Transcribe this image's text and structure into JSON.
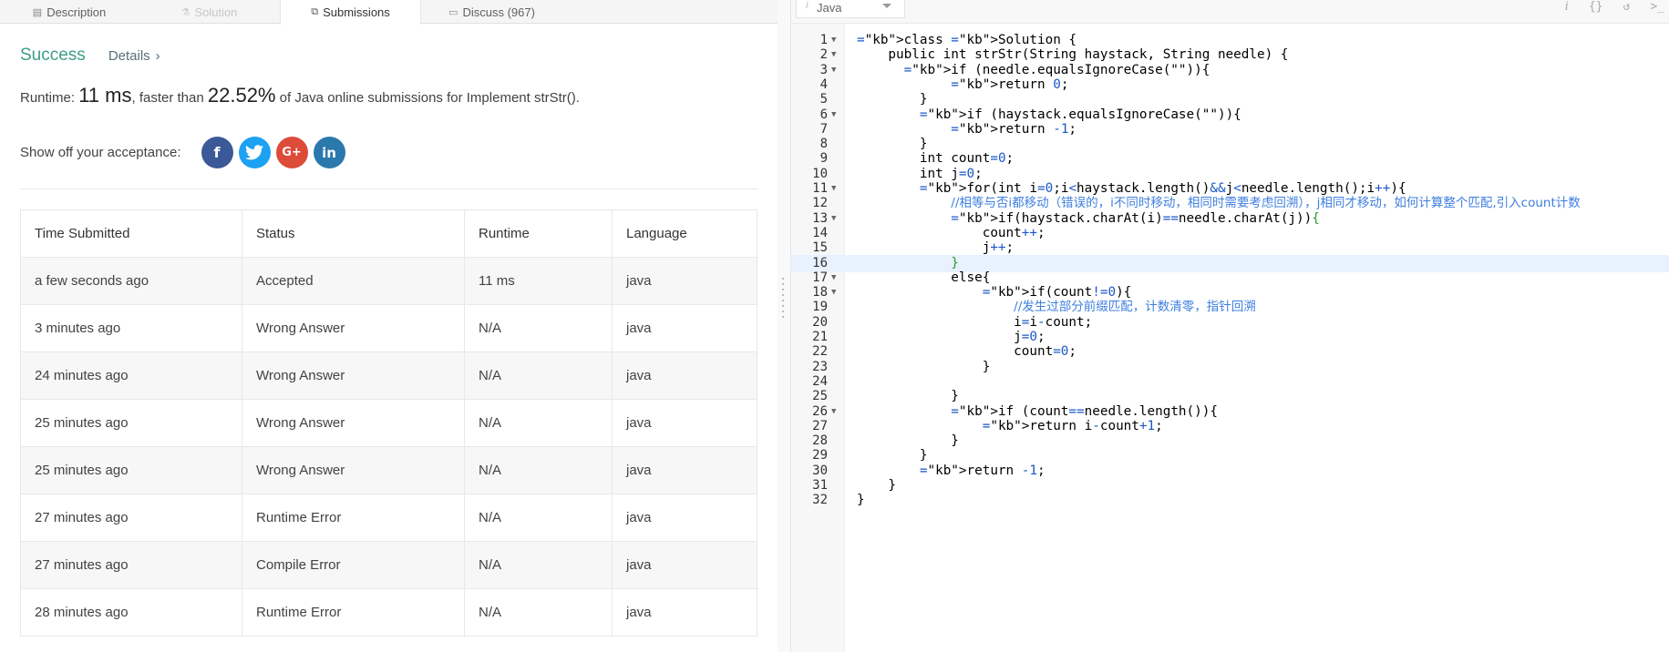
{
  "tabs": [
    {
      "icon": "description-icon",
      "glyph": "▤",
      "label": "Description",
      "state": "normal"
    },
    {
      "icon": "solution-icon",
      "glyph": "⚗",
      "label": "Solution",
      "state": "disabled"
    },
    {
      "icon": "submissions-icon",
      "glyph": "⧉",
      "label": "Submissions",
      "state": "active"
    },
    {
      "icon": "discuss-icon",
      "glyph": "▭",
      "label": "Discuss (967)",
      "state": "normal"
    }
  ],
  "result": {
    "status": "Success",
    "details_label": "Details",
    "details_chevron": "›",
    "runtime_prefix": "Runtime: ",
    "runtime_value": "11 ms",
    "runtime_mid": ", faster than ",
    "percent": "22.52%",
    "runtime_suffix": " of Java online submissions for Implement strStr()."
  },
  "share": {
    "label": "Show off your acceptance:",
    "buttons": [
      {
        "name": "facebook-icon",
        "glyph": "f",
        "cls": "fb"
      },
      {
        "name": "twitter-icon",
        "glyph": "🐦",
        "cls": "tw"
      },
      {
        "name": "google-plus-icon",
        "glyph": "G+",
        "cls": "gp"
      },
      {
        "name": "linkedin-icon",
        "glyph": "in",
        "cls": "li"
      }
    ]
  },
  "table": {
    "headers": [
      "Time Submitted",
      "Status",
      "Runtime",
      "Language"
    ],
    "rows": [
      {
        "time": "a few seconds ago",
        "status": "Accepted",
        "ok": true,
        "runtime": "11 ms",
        "language": "java"
      },
      {
        "time": "3 minutes ago",
        "status": "Wrong Answer",
        "ok": false,
        "runtime": "N/A",
        "language": "java"
      },
      {
        "time": "24 minutes ago",
        "status": "Wrong Answer",
        "ok": false,
        "runtime": "N/A",
        "language": "java"
      },
      {
        "time": "25 minutes ago",
        "status": "Wrong Answer",
        "ok": false,
        "runtime": "N/A",
        "language": "java"
      },
      {
        "time": "25 minutes ago",
        "status": "Wrong Answer",
        "ok": false,
        "runtime": "N/A",
        "language": "java"
      },
      {
        "time": "27 minutes ago",
        "status": "Runtime Error",
        "ok": false,
        "runtime": "N/A",
        "language": "java"
      },
      {
        "time": "27 minutes ago",
        "status": "Compile Error",
        "ok": false,
        "runtime": "N/A",
        "language": "java"
      },
      {
        "time": "28 minutes ago",
        "status": "Runtime Error",
        "ok": false,
        "runtime": "N/A",
        "language": "java"
      }
    ]
  },
  "editor": {
    "language_icon": "i",
    "language": "Java",
    "toolbar_icons": [
      {
        "name": "info-icon",
        "glyph": "i"
      },
      {
        "name": "braces-icon",
        "glyph": "{}"
      },
      {
        "name": "reset-icon",
        "glyph": "↺"
      },
      {
        "name": "console-icon",
        "glyph": ">_"
      }
    ],
    "active_line": 16,
    "lines": [
      {
        "n": 1,
        "fold": true,
        "html": "class Solution {"
      },
      {
        "n": 2,
        "fold": true,
        "html": "    public int strStr(String haystack, String needle) {"
      },
      {
        "n": 3,
        "fold": true,
        "html": "      if (needle.equalsIgnoreCase(\"\")){"
      },
      {
        "n": 4,
        "fold": false,
        "html": "            return <b>0</b>;"
      },
      {
        "n": 5,
        "fold": false,
        "html": "        }"
      },
      {
        "n": 6,
        "fold": true,
        "html": "        if (haystack.equalsIgnoreCase(\"\")){"
      },
      {
        "n": 7,
        "fold": false,
        "html": "            return -1;"
      },
      {
        "n": 8,
        "fold": false,
        "html": "        }"
      },
      {
        "n": 9,
        "fold": false,
        "html": "        int count=0;"
      },
      {
        "n": 10,
        "fold": false,
        "html": "        int j=0;"
      },
      {
        "n": 11,
        "fold": true,
        "html": "        for(int i=0;i<haystack.length()&&j<needle.length();i++){"
      },
      {
        "n": 12,
        "fold": false,
        "html": "            //相等与否i都移动（错误的，i不同时移动，相同时需要考虑回溯），j相同才移动，如何计算整个匹配,引入count计数"
      },
      {
        "n": 13,
        "fold": true,
        "html": "            if(haystack.charAt(i)==needle.charAt(j)){"
      },
      {
        "n": 14,
        "fold": false,
        "html": "                count++;"
      },
      {
        "n": 15,
        "fold": false,
        "html": "                j++;"
      },
      {
        "n": 16,
        "fold": false,
        "html": "            }"
      },
      {
        "n": 17,
        "fold": true,
        "html": "            else{"
      },
      {
        "n": 18,
        "fold": true,
        "html": "                if(count!=0){"
      },
      {
        "n": 19,
        "fold": false,
        "html": "                    //发生过部分前缀匹配，计数清零，指针回溯"
      },
      {
        "n": 20,
        "fold": false,
        "html": "                    i=i-count;"
      },
      {
        "n": 21,
        "fold": false,
        "html": "                    j=0;"
      },
      {
        "n": 22,
        "fold": false,
        "html": "                    count=0;"
      },
      {
        "n": 23,
        "fold": false,
        "html": "                }"
      },
      {
        "n": 24,
        "fold": false,
        "html": ""
      },
      {
        "n": 25,
        "fold": false,
        "html": "            }"
      },
      {
        "n": 26,
        "fold": true,
        "html": "            if (count==needle.length()){"
      },
      {
        "n": 27,
        "fold": false,
        "html": "                return i-count+1;"
      },
      {
        "n": 28,
        "fold": false,
        "html": "            }"
      },
      {
        "n": 29,
        "fold": false,
        "html": "        }"
      },
      {
        "n": 30,
        "fold": false,
        "html": "        return -1;"
      },
      {
        "n": 31,
        "fold": false,
        "html": "    }"
      },
      {
        "n": 32,
        "fold": false,
        "html": "}"
      }
    ]
  }
}
